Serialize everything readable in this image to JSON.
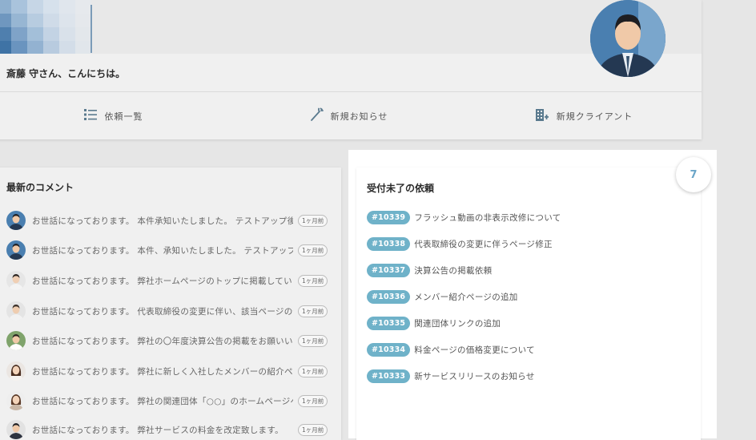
{
  "profile": {
    "greeting": "斎藤 守さん、こんにちは。"
  },
  "actions": [
    {
      "label": "依頼一覧",
      "icon": "list-icon"
    },
    {
      "label": "新規お知らせ",
      "icon": "magic-pen-icon"
    },
    {
      "label": "新規クライアント",
      "icon": "building-add-icon"
    }
  ],
  "comments": {
    "title": "最新のコメント",
    "items": [
      {
        "text": "お世話になっております。 本件承知いたしました。 テストアップ後に改めてご確認をお願いいたします。",
        "badge": "1ヶ月前"
      },
      {
        "text": "お世話になっております。 本件、承知いたしました。 テストアップ後にご連絡いたします。",
        "badge": "1ヶ月前"
      },
      {
        "text": "お世話になっております。 弊社ホームページのトップに掲載している動画について",
        "badge": "1ヶ月前"
      },
      {
        "text": "お世話になっております。 代表取締役の変更に伴い、該当ページの修正をお願いします",
        "badge": "1ヶ月前"
      },
      {
        "text": "お世話になっております。 弊社の〇年度決算公告の掲載をお願いいたします。",
        "badge": "1ヶ月前"
      },
      {
        "text": "お世話になっております。 弊社に新しく入社したメンバーの紹介ページについて",
        "badge": "1ヶ月前"
      },
      {
        "text": "お世話になっております。 弊社の関連団体「○○」のホームページへのリンクについて",
        "badge": "1ヶ月前"
      },
      {
        "text": "お世話になっております。 弊社サービスの料金を改定致します。",
        "badge": "1ヶ月前"
      }
    ]
  },
  "requests": {
    "title": "受付未了の依頼",
    "count": "7",
    "items": [
      {
        "id": "#10339",
        "title": "フラッシュ動画の非表示改修について"
      },
      {
        "id": "#10338",
        "title": "代表取締役の変更に伴うページ修正"
      },
      {
        "id": "#10337",
        "title": "決算公告の掲載依頼"
      },
      {
        "id": "#10336",
        "title": "メンバー紹介ページの追加"
      },
      {
        "id": "#10335",
        "title": "関連団体リンクの追加"
      },
      {
        "id": "#10334",
        "title": "料金ページの価格変更について"
      },
      {
        "id": "#10333",
        "title": "新サービスリリースのお知らせ"
      }
    ]
  },
  "colors": {
    "accent": "#6fb2c9",
    "count_text": "#6aa5c8",
    "background": "#e6e6e6"
  }
}
